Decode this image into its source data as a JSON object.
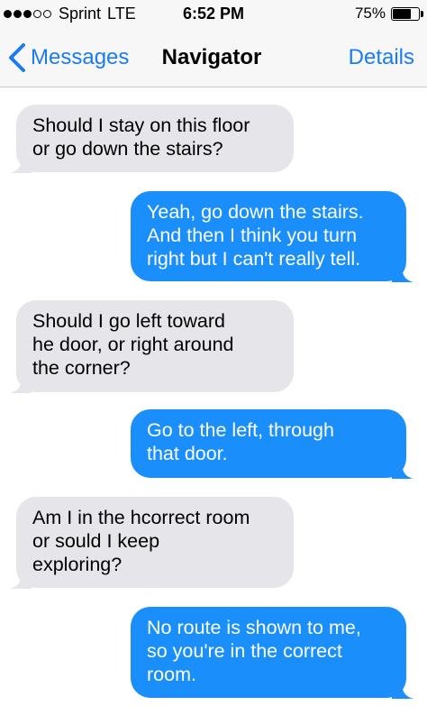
{
  "status": {
    "carrier": "Sprint",
    "network": "LTE",
    "time": "6:52 PM",
    "battery": "75%",
    "battery_level": 0.75,
    "signal_bars": 3,
    "signal_total": 5
  },
  "nav": {
    "back_label": "Messages",
    "title": "Navigator",
    "details_label": "Details"
  },
  "colors": {
    "accent": "#1a7cf5",
    "sent_bubble": "#1a8ffb",
    "received_bubble": "#e5e5ea"
  },
  "messages": [
    {
      "direction": "received",
      "text": "Should I stay on this floor\nor go down the stairs?"
    },
    {
      "direction": "sent",
      "text": "Yeah, go down the stairs.\nAnd then I think you turn\nright but I can't really tell."
    },
    {
      "direction": "received",
      "text": "Should I go left toward\nhe door, or right around\nthe corner?"
    },
    {
      "direction": "sent",
      "text": "Go to the left, through\nthat door."
    },
    {
      "direction": "received",
      "text": "Am I in the hcorrect room\nor sould I keep\nexploring?"
    },
    {
      "direction": "sent",
      "text": "No route is shown to me,\nso you're in the correct\nroom."
    }
  ]
}
